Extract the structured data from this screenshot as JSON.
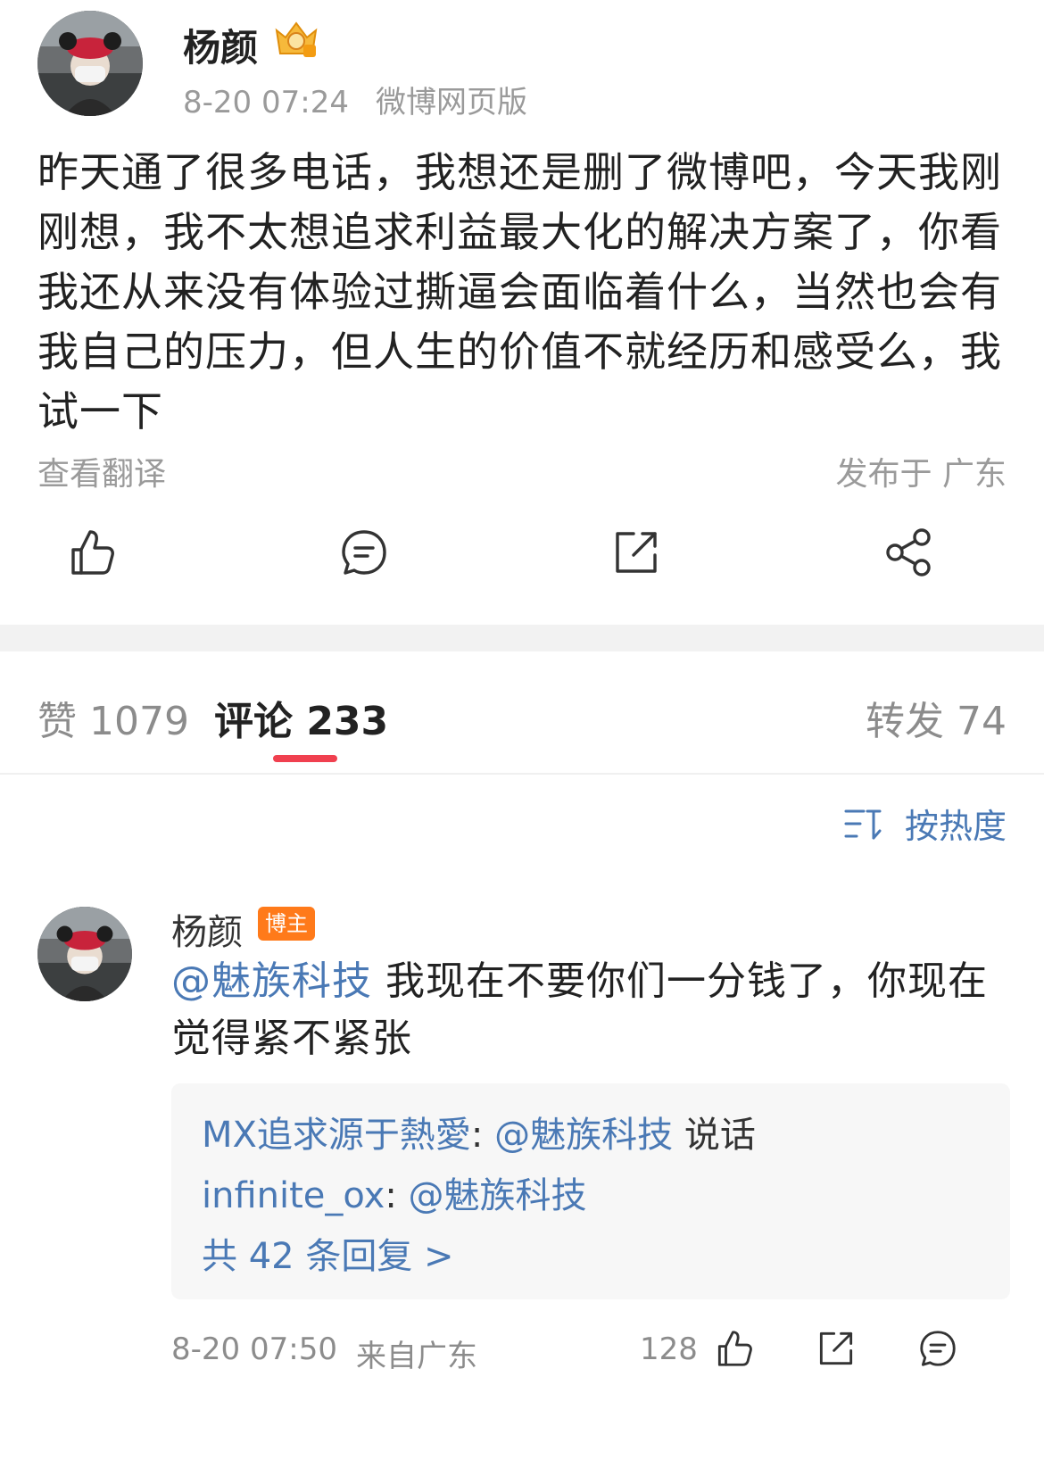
{
  "post": {
    "author": "杨颜",
    "time": "8-20 07:24",
    "source": "微博网页版",
    "body": "昨天通了很多电话，我想还是删了微博吧，今天我刚刚想，我不太想追求利益最大化的解决方案了，你看我还从来没有体验过撕逼会面临着什么，当然也会有我自己的压力，但人生的价值不就经历和感受么，我试一下",
    "translate": "查看翻译",
    "location": "发布于 广东"
  },
  "tabs": {
    "likes": "赞 1079",
    "comments": "评论 233",
    "reposts": "转发 74"
  },
  "sort": {
    "label": "按热度"
  },
  "comment": {
    "author": "杨颜",
    "badge": "博主",
    "mention": "@魅族科技",
    "text": " 我现在不要你们一分钱了，你现在觉得紧不紧张",
    "replies": [
      {
        "user": "MX追求源于熱愛",
        "sep": ": ",
        "mention": "@魅族科技",
        "text": " 说话"
      },
      {
        "user": "infinite_ox",
        "sep": ": ",
        "mention": "@魅族科技",
        "text": ""
      }
    ],
    "more": "共 42 条回复 >",
    "time": "8-20 07:50",
    "from": "来自广东",
    "likes": "128"
  },
  "colors": {
    "link": "#4a79b5",
    "accent": "#f0404f",
    "badge": "#ff7a1a",
    "muted": "#9a9a9a"
  },
  "icons": [
    "crown-badge-icon",
    "like-icon",
    "comment-icon",
    "repost-icon",
    "share-icon",
    "sort-icon"
  ]
}
